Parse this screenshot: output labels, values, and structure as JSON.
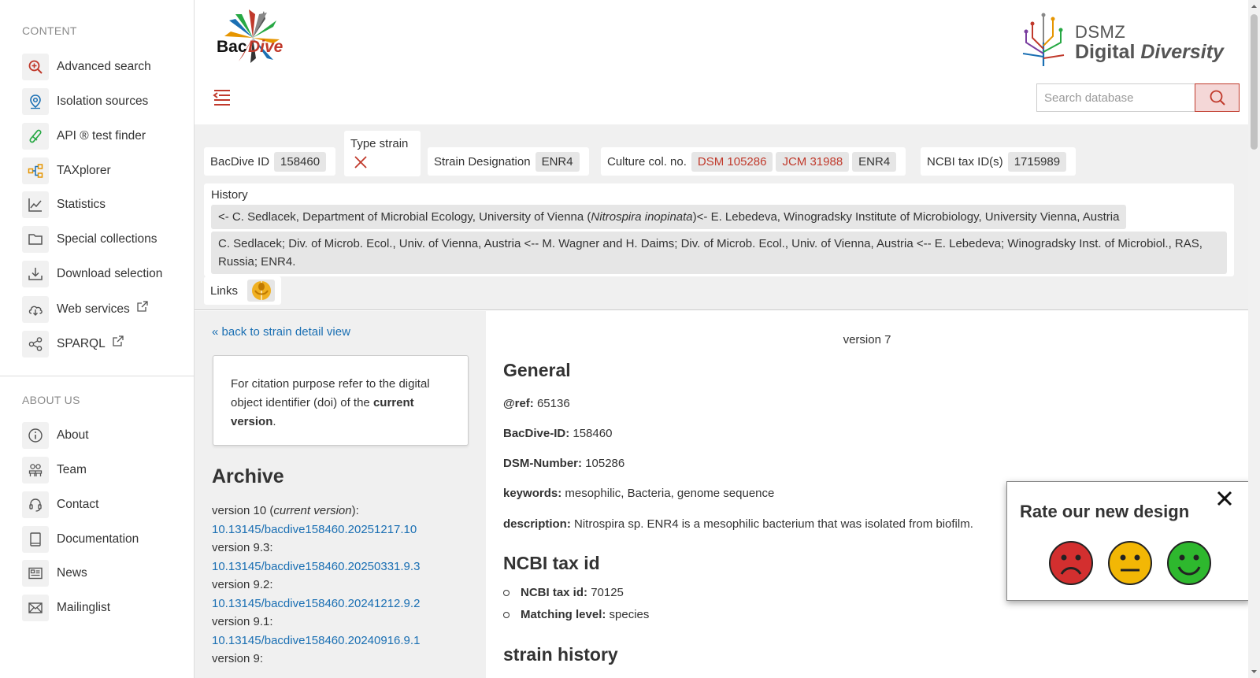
{
  "sidebar": {
    "content_heading": "CONTENT",
    "content_items": [
      {
        "label": "Advanced search",
        "icon": "search-plus-icon"
      },
      {
        "label": "Isolation sources",
        "icon": "map-pin-icon"
      },
      {
        "label": "API ® test finder",
        "icon": "test-tube-icon"
      },
      {
        "label": "TAXplorer",
        "icon": "tree-icon"
      },
      {
        "label": "Statistics",
        "icon": "chart-icon"
      },
      {
        "label": "Special collections",
        "icon": "folder-icon"
      },
      {
        "label": "Download selection",
        "icon": "download-icon"
      },
      {
        "label": "Web services",
        "icon": "cloud-download-icon"
      },
      {
        "label": "SPARQL",
        "icon": "share-nodes-icon"
      }
    ],
    "about_heading": "ABOUT US",
    "about_items": [
      {
        "label": "About",
        "icon": "info-icon"
      },
      {
        "label": "Team",
        "icon": "team-icon"
      },
      {
        "label": "Contact",
        "icon": "headset-icon"
      },
      {
        "label": "Documentation",
        "icon": "book-icon"
      },
      {
        "label": "News",
        "icon": "newspaper-icon"
      },
      {
        "label": "Mailinglist",
        "icon": "envelope-icon"
      }
    ]
  },
  "header": {
    "logo_text": "BacDive",
    "dsmz_line1": "DSMZ",
    "dsmz_line2a": "Digital ",
    "dsmz_line2b": "Diversity",
    "search_placeholder": "Search database"
  },
  "infobar": {
    "bacdive_id_label": "BacDive ID",
    "bacdive_id_value": "158460",
    "type_strain_label": "Type strain",
    "strain_designation_label": "Strain Designation",
    "strain_designation_value": "ENR4",
    "culture_col_label": "Culture col. no.",
    "culture_col_values": [
      "DSM 105286",
      "JCM 31988",
      "ENR4"
    ],
    "ncbi_label": "NCBI tax ID(s)",
    "ncbi_value": "1715989",
    "history_label": "History",
    "history_row1_pre": "<- C. Sedlacek, Department of Microbial Ecology, University of Vienna (",
    "history_row1_italic": "Nitrospira inopinata",
    "history_row1_post": ")<- E. Lebedeva, Winogradsky Institute of Microbiology, University Vienna, Austria",
    "history_row2": "C. Sedlacek; Div. of Microb. Ecol., Univ. of Vienna, Austria <-- M. Wagner and H. Daims; Div. of Microb. Ecol., Univ. of Vienna, Austria <-- E. Lebedeva; Winogradsky Inst. of Microbiol., RAS, Russia; ENR4.",
    "links_label": "Links"
  },
  "leftcol": {
    "back_link": "« back to strain detail view",
    "cite_text_pre": "For citation purpose refer to the digital object identifier (doi) of the ",
    "cite_text_bold": "current version",
    "cite_text_post": ".",
    "archive_title": "Archive",
    "archive": [
      {
        "version": "version 10 (",
        "version_italic": "current version",
        "version_post": "):",
        "doi": "10.13145/bacdive158460.20251217.10"
      },
      {
        "version": "version 9.3:",
        "version_italic": "",
        "version_post": "",
        "doi": "10.13145/bacdive158460.20250331.9.3"
      },
      {
        "version": "version 9.2:",
        "version_italic": "",
        "version_post": "",
        "doi": "10.13145/bacdive158460.20241212.9.2"
      },
      {
        "version": "version 9.1:",
        "version_italic": "",
        "version_post": "",
        "doi": "10.13145/bacdive158460.20240916.9.1"
      },
      {
        "version": "version 9:",
        "version_italic": "",
        "version_post": "",
        "doi": ""
      }
    ]
  },
  "main": {
    "version_label": "version 7",
    "general_title": "General",
    "ref_label": "@ref:",
    "ref_value": "65136",
    "bacdive_id_label": "BacDive-ID:",
    "bacdive_id_value": "158460",
    "dsm_label": "DSM-Number:",
    "dsm_value": "105286",
    "keywords_label": "keywords:",
    "keywords_value": "mesophilic, Bacteria, genome sequence",
    "description_label": "description:",
    "description_value": "Nitrospira sp. ENR4 is a mesophilic bacterium that was isolated from biofilm.",
    "ncbi_title": "NCBI tax id",
    "ncbi_taxid_label": "NCBI tax id:",
    "ncbi_taxid_value": "70125",
    "matching_label": "Matching level:",
    "matching_value": "species",
    "strain_history_title": "strain history"
  },
  "rating": {
    "title": "Rate our new design",
    "faces": [
      "sad-face-icon",
      "neutral-face-icon",
      "happy-face-icon"
    ]
  },
  "colors": {
    "accent_red": "#c0392b",
    "link_blue": "#1a6fb3",
    "panel_grey": "#f0f0f0"
  }
}
